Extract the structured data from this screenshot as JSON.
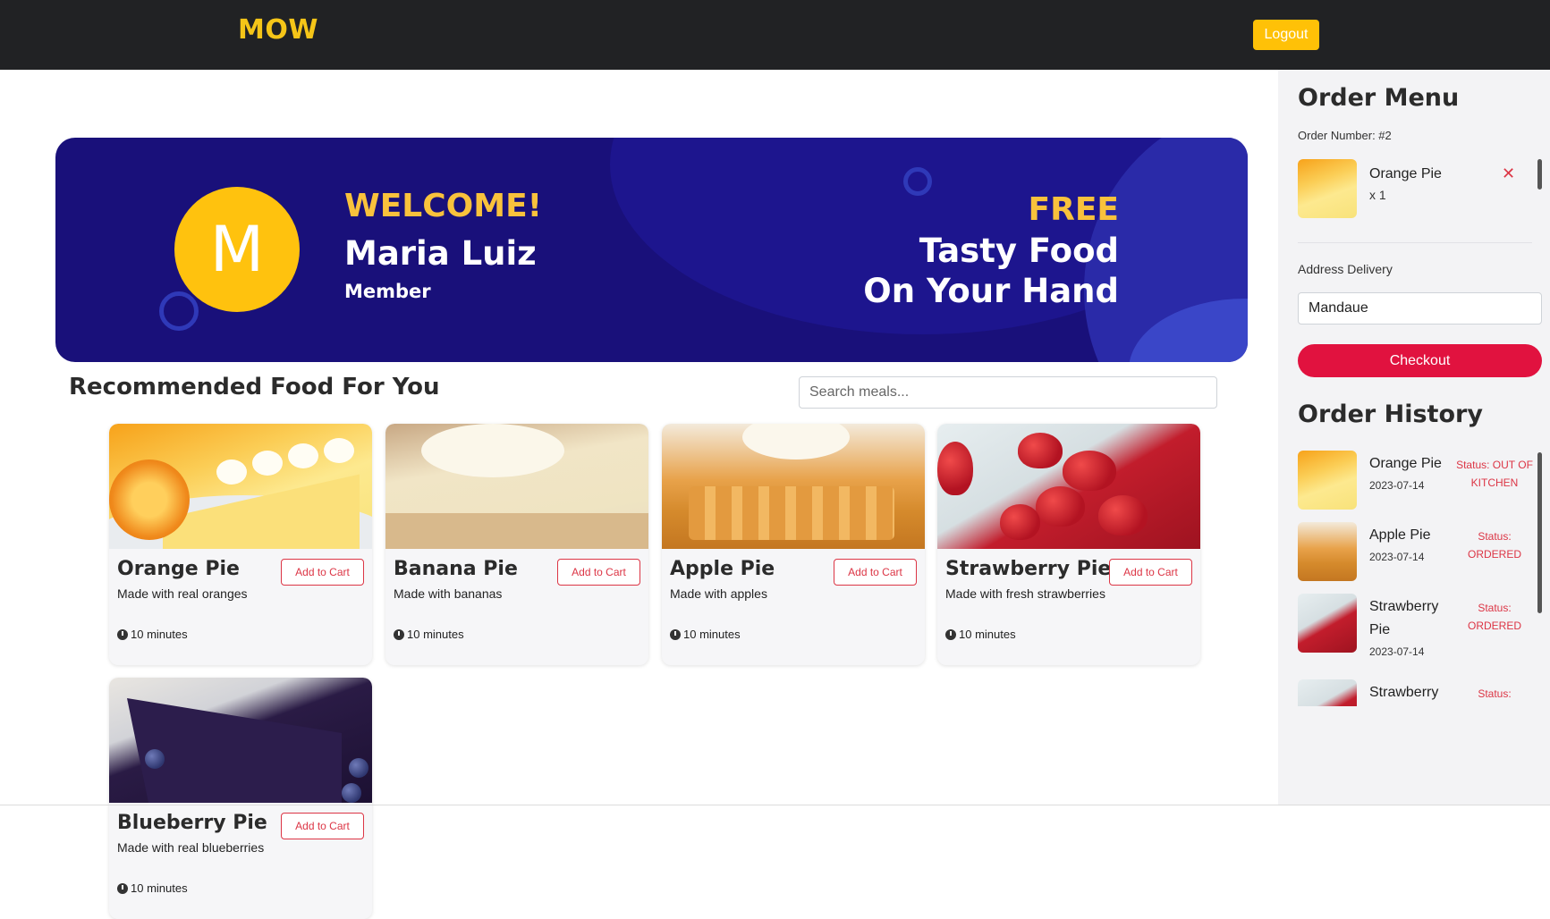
{
  "header": {
    "brand": "MOW",
    "logout_label": "Logout"
  },
  "banner": {
    "avatar_letter": "M",
    "welcome": "WELCOME!",
    "user_name": "Maria Luiz",
    "role": "Member",
    "promo_tag": "FREE",
    "promo_line1": "Tasty Food",
    "promo_line2": "On Your Hand"
  },
  "main": {
    "section_title": "Recommended Food For You",
    "search_placeholder": "Search meals...",
    "add_label": "Add to Cart",
    "foods": [
      {
        "name": "Orange Pie",
        "desc": "Made with real oranges",
        "time": "10 minutes"
      },
      {
        "name": "Banana Pie",
        "desc": "Made with bananas",
        "time": "10 minutes"
      },
      {
        "name": "Apple Pie",
        "desc": "Made with apples",
        "time": "10 minutes"
      },
      {
        "name": "Strawberry Pie",
        "desc": "Made with fresh strawberries",
        "time": "10 minutes"
      },
      {
        "name": "Blueberry Pie",
        "desc": "Made with real blueberries",
        "time": "10 minutes"
      }
    ]
  },
  "order_menu": {
    "title": "Order Menu",
    "order_number": "Order Number: #2",
    "items": [
      {
        "name": "Orange Pie",
        "qty": "x 1"
      }
    ],
    "remove_symbol": "✕",
    "address_label": "Address Delivery",
    "address_value": "Mandaue",
    "checkout_label": "Checkout"
  },
  "order_history": {
    "title": "Order History",
    "items": [
      {
        "name": "Orange Pie",
        "date": "2023-07-14",
        "status": "Status: OUT OF KITCHEN"
      },
      {
        "name": "Apple Pie",
        "date": "2023-07-14",
        "status": "Status: ORDERED"
      },
      {
        "name": "Strawberry Pie",
        "date": "2023-07-14",
        "status": "Status: ORDERED"
      },
      {
        "name": "Strawberry",
        "date": "",
        "status": "Status:"
      }
    ]
  },
  "colors": {
    "accent": "#ffc107",
    "danger": "#dc3545",
    "banner": "#19107a",
    "checkout": "#e1123f"
  }
}
